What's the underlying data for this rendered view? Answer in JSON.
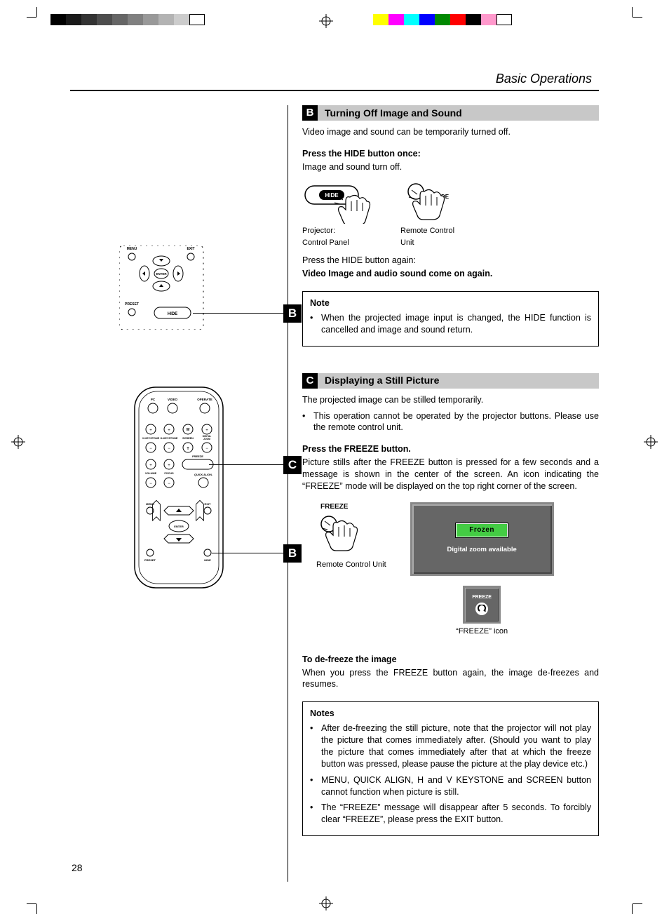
{
  "header": {
    "title": "Basic Operations"
  },
  "page_number": "28",
  "sectionB": {
    "tag": "B",
    "title": "Turning Off Image and Sound",
    "intro": "Video image and sound can be temporarily turned off.",
    "step1_head": "Press the HIDE button once:",
    "step1_body": "Image and sound turn off.",
    "diagram": {
      "hide_btn_label": "HIDE",
      "projector_caption_1": "Projector:",
      "projector_caption_2": "Control Panel",
      "remote_hide_label": "HIDE",
      "remote_caption_1": "Remote Control",
      "remote_caption_2": "Unit"
    },
    "step2_head": "Press the HIDE button again:",
    "step2_body": "Video Image and audio sound come on again.",
    "note": {
      "title": "Note",
      "item1": "When the projected image input is changed, the HIDE function is cancelled and image and sound return."
    }
  },
  "sectionC": {
    "tag": "C",
    "title": "Displaying a Still Picture",
    "intro": "The projected image can be stilled temporarily.",
    "bullet1": "This operation cannot be operated by the projector buttons. Please use the remote control unit.",
    "step1_head": "Press the FREEZE button.",
    "step1_body": "Picture stills after the FREEZE button is pressed for a few seconds and a message is shown in the center of the screen. An icon indicating the “FREEZE” mode will be displayed on the top right corner of the screen.",
    "diagram": {
      "freeze_label": "FREEZE",
      "remote_caption": "Remote Control Unit",
      "frozen_badge": "Frozen",
      "zoom_text": "Digital zoom available",
      "icon_caption": "“FREEZE” icon",
      "icon_label": "FREEZE"
    },
    "defreeze_head": "To de-freeze the image",
    "defreeze_body": "When you press the FREEZE button again, the image de-freezes and resumes.",
    "notes": {
      "title": "Notes",
      "item1": "After de-freezing the still picture, note that the projector will not play the picture that comes immediately after. (Should you want to play the picture that comes immediately after that at which the freeze button was pressed, please pause the picture at the play device etc.)",
      "item2": "MENU, QUICK ALIGN, H and V KEYSTONE and SCREEN button cannot function when picture is still.",
      "item3": "The “FREEZE” message will disappear after 5 seconds. To forcibly clear “FREEZE”, please press the EXIT button."
    }
  },
  "left_diagram": {
    "panel": {
      "menu": "MENU",
      "exit": "EXIT",
      "preset": "PRESET",
      "hide": "HIDE",
      "enter": "ENTER"
    },
    "remote": {
      "pc": "PC",
      "video": "VIDEO",
      "operate": "OPERATE",
      "vkeystone": "V-KEYSTONE",
      "hkeystone": "H-KEYSTONE",
      "screen_w": "W",
      "screen_t": "T",
      "screen": "SCREEN",
      "digital": "DIGITAL ZOOM",
      "volume": "VOLUME",
      "focus": "FOCUS",
      "freeze": "FREEZE",
      "quickalign": "QUICK ALIGN.",
      "menu": "MENU",
      "exit": "EXIT",
      "enter": "ENTER",
      "preset": "PRESET",
      "hide": "HIDE"
    },
    "tagB": "B",
    "tagC": "C"
  },
  "colors": {
    "grays": [
      "#000000",
      "#1a1a1a",
      "#333333",
      "#4d4d4d",
      "#666666",
      "#808080",
      "#999999",
      "#b3b3b3",
      "#cccccc",
      "#ffffff"
    ],
    "cmyk": [
      "#ffff00",
      "#ff00ff",
      "#00ffff",
      "#0000ff",
      "#008000",
      "#ff0000",
      "#000000",
      "#ff99cc",
      "#ffffff"
    ]
  }
}
